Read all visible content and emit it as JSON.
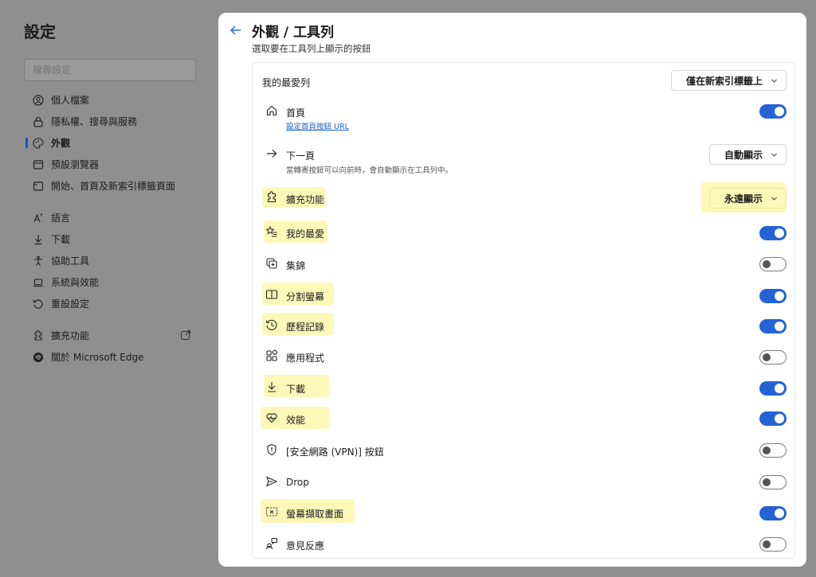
{
  "sidebar": {
    "title": "設定",
    "search_placeholder": "搜尋設定",
    "items": [
      {
        "label": "個人檔案",
        "icon": "profile-icon"
      },
      {
        "label": "隱私權、搜尋與服務",
        "icon": "lock-icon"
      },
      {
        "label": "外觀",
        "icon": "palette-icon",
        "active": true
      },
      {
        "label": "預設瀏覽器",
        "icon": "browser-icon"
      },
      {
        "label": "開始、首頁及新索引標籤頁面",
        "icon": "start-page-icon"
      },
      {
        "label": "語言",
        "icon": "language-icon"
      },
      {
        "label": "下載",
        "icon": "download-icon"
      },
      {
        "label": "協助工具",
        "icon": "accessibility-icon"
      },
      {
        "label": "系統與效能",
        "icon": "laptop-icon"
      },
      {
        "label": "重設設定",
        "icon": "reset-icon"
      },
      {
        "label": "擴充功能",
        "icon": "extension-icon",
        "external": true
      },
      {
        "label": "關於 Microsoft Edge",
        "icon": "edge-logo-icon"
      }
    ]
  },
  "header": {
    "title": "外觀 / 工具列",
    "subtitle": "選取要在工具列上顯示的按鈕"
  },
  "rows": {
    "favorites_bar": {
      "label": "我的最愛列",
      "dropdown": "僅在新索引標籤上"
    },
    "home": {
      "label": "首頁",
      "link": "設定首頁按鈕 URL",
      "on": true
    },
    "forward": {
      "label": "下一頁",
      "desc": "當轉寄按鈕可以向前時，會自動顯示在工具列中。",
      "dropdown": "自動顯示"
    },
    "extensions": {
      "label": "擴充功能",
      "dropdown": "永遠顯示"
    },
    "favorites": {
      "label": "我的最愛",
      "on": true
    },
    "collections": {
      "label": "集錦",
      "on": false
    },
    "split_screen": {
      "label": "分割螢幕",
      "on": true
    },
    "history": {
      "label": "歷程記錄",
      "on": true
    },
    "apps": {
      "label": "應用程式",
      "on": false
    },
    "downloads": {
      "label": "下載",
      "on": true
    },
    "performance": {
      "label": "效能",
      "on": true
    },
    "vpn": {
      "label": "[安全網路 (VPN)] 按鈕",
      "on": false
    },
    "drop": {
      "label": "Drop",
      "on": false
    },
    "screenshot": {
      "label": "螢幕擷取畫面",
      "on": true
    },
    "feedback": {
      "label": "意見反應",
      "on": false
    }
  },
  "colors": {
    "accent": "#2463d6",
    "highlight": "#fdf8b8",
    "backdrop": "#8f8f8f"
  }
}
